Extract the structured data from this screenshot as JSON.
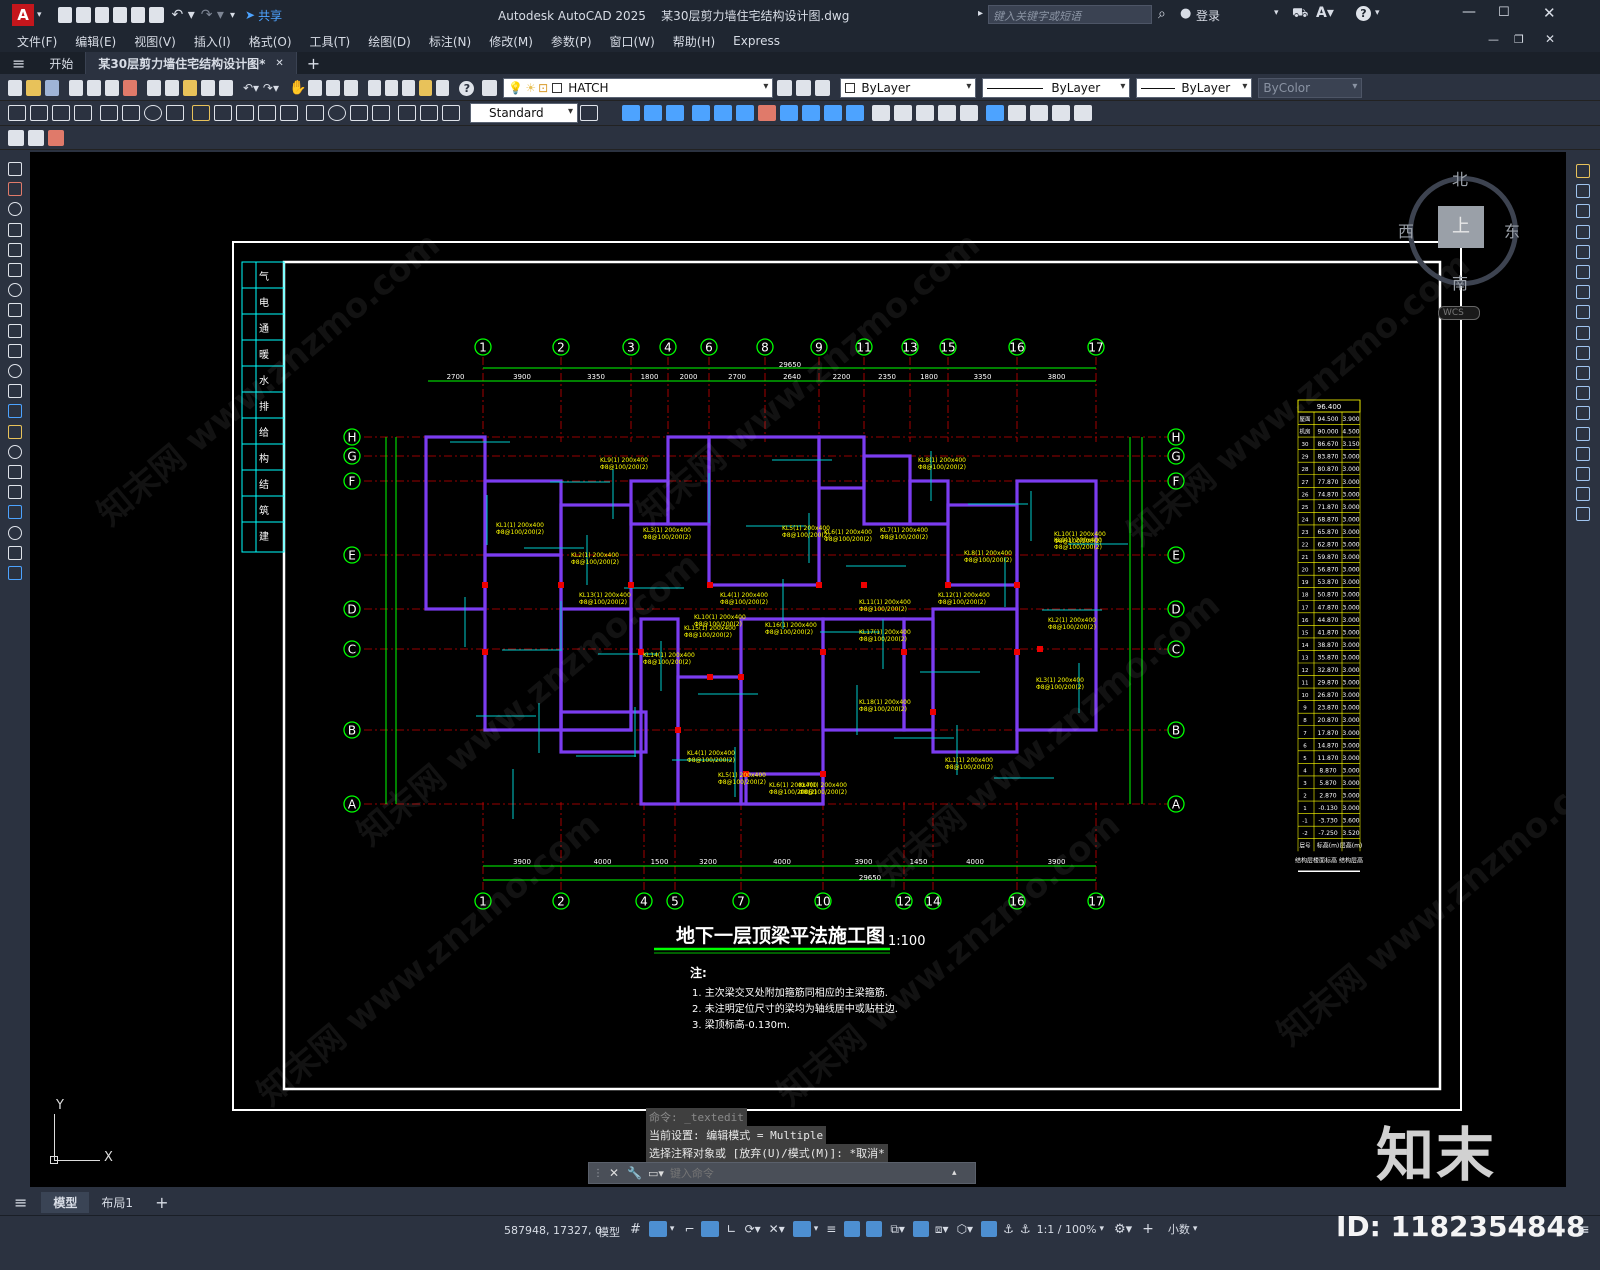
{
  "titlebar": {
    "app_letter": "A",
    "share_label": "共享",
    "title": "Autodesk AutoCAD 2025    某30层剪力墙住宅结构设计图.dwg",
    "search_placeholder": "键入关键字或短语",
    "login_label": "登录"
  },
  "menu": [
    "文件(F)",
    "编辑(E)",
    "视图(V)",
    "插入(I)",
    "格式(O)",
    "工具(T)",
    "绘图(D)",
    "标注(N)",
    "修改(M)",
    "参数(P)",
    "窗口(W)",
    "帮助(H)",
    "Express"
  ],
  "tabs": {
    "start": "开始",
    "doc": "某30层剪力墙住宅结构设计图*",
    "close": "✕",
    "add": "+"
  },
  "toolbar": {
    "layer": "HATCH",
    "color": "ByLayer",
    "linetype": "ByLayer",
    "lineweight": "ByLayer",
    "plotstyle": "ByColor",
    "dimstyle": "Standard"
  },
  "viewcube": {
    "north": "北",
    "south": "南",
    "east": "东",
    "west": "西",
    "top": "上",
    "wcs": "WCS"
  },
  "drawing": {
    "title": "地下一层顶梁平法施工图",
    "scale": "1:100",
    "note_head": "注:",
    "notes": [
      "1.  主次梁交叉处附加箍筋同相应的主梁箍筋.",
      "2.  未注明定位尺寸的梁均为轴线居中或贴柱边.",
      "3.  梁顶标高-0.130m."
    ],
    "axes_top": [
      "1",
      "2",
      "3",
      "4",
      "6",
      "8",
      "9",
      "11",
      "13",
      "15",
      "16",
      "17"
    ],
    "axes_bottom": [
      "1",
      "2",
      "4",
      "5",
      "7",
      "10",
      "12",
      "14",
      "16",
      "17"
    ],
    "axes_rows": [
      "H",
      "G",
      "F",
      "E",
      "D",
      "C",
      "B",
      "A"
    ],
    "dims_top": [
      "2700",
      "3900",
      "3350",
      "1800",
      "2000",
      "2700",
      "2640",
      "2200",
      "2350",
      "1800",
      "3350",
      "3800"
    ],
    "dims_bottom": [
      "3900",
      "4000",
      "1500",
      "3200",
      "4000",
      "3900",
      "1450",
      "4000",
      "3900"
    ],
    "total_dim": "29650",
    "side_labels": [
      "建",
      "筑",
      "结",
      "构",
      "给",
      "排",
      "水",
      "暖",
      "通",
      "电",
      "气"
    ],
    "table_head": "96.400",
    "table_rows": [
      [
        "屋面",
        "94.500",
        "3.900"
      ],
      [
        "机房",
        "90.000",
        "4.500"
      ],
      [
        "30",
        "86.670",
        "3.150"
      ],
      [
        "29",
        "83.870",
        "3.000"
      ],
      [
        "28",
        "80.870",
        "3.000"
      ],
      [
        "27",
        "77.870",
        "3.000"
      ],
      [
        "26",
        "74.870",
        "3.000"
      ],
      [
        "25",
        "71.870",
        "3.000"
      ],
      [
        "24",
        "68.870",
        "3.000"
      ],
      [
        "23",
        "65.870",
        "3.000"
      ],
      [
        "22",
        "62.870",
        "3.000"
      ],
      [
        "21",
        "59.870",
        "3.000"
      ],
      [
        "20",
        "56.870",
        "3.000"
      ],
      [
        "19",
        "53.870",
        "3.000"
      ],
      [
        "18",
        "50.870",
        "3.000"
      ],
      [
        "17",
        "47.870",
        "3.000"
      ],
      [
        "16",
        "44.870",
        "3.000"
      ],
      [
        "15",
        "41.870",
        "3.000"
      ],
      [
        "14",
        "38.870",
        "3.000"
      ],
      [
        "13",
        "35.870",
        "3.000"
      ],
      [
        "12",
        "32.870",
        "3.000"
      ],
      [
        "11",
        "29.870",
        "3.000"
      ],
      [
        "10",
        "26.870",
        "3.000"
      ],
      [
        "9",
        "23.870",
        "3.000"
      ],
      [
        "8",
        "20.870",
        "3.000"
      ],
      [
        "7",
        "17.870",
        "3.000"
      ],
      [
        "6",
        "14.870",
        "3.000"
      ],
      [
        "5",
        "11.870",
        "3.000"
      ],
      [
        "4",
        "8.870",
        "3.000"
      ],
      [
        "3",
        "5.870",
        "3.000"
      ],
      [
        "2",
        "2.870",
        "3.000"
      ],
      [
        "1",
        "-0.130",
        "3.000"
      ],
      [
        "-1",
        "-3.730",
        "3.600"
      ],
      [
        "-2",
        "-7.250",
        "3.520"
      ],
      [
        "层号",
        "标高(m)",
        "层高(m)"
      ]
    ],
    "table_foot": "结构层楼面标高 结构层高"
  },
  "command": {
    "line1": "命令: _textedit",
    "line2": "当前设置: 编辑模式 = Multiple",
    "line3": "选择注释对象或 [放弃(U)/模式(M)]: *取消*",
    "placeholder": "键入命令"
  },
  "ucs": {
    "x": "X",
    "y": "Y"
  },
  "watermark": {
    "brand": "知末",
    "id": "ID: 1182354848",
    "site": "知末网 www.znzmo.com"
  },
  "layout_tabs": [
    "模型",
    "布局1"
  ],
  "status": {
    "coords": "587948, 17327, 0",
    "model": "模型",
    "scale": "1:1 / 100%",
    "units": "小数"
  }
}
